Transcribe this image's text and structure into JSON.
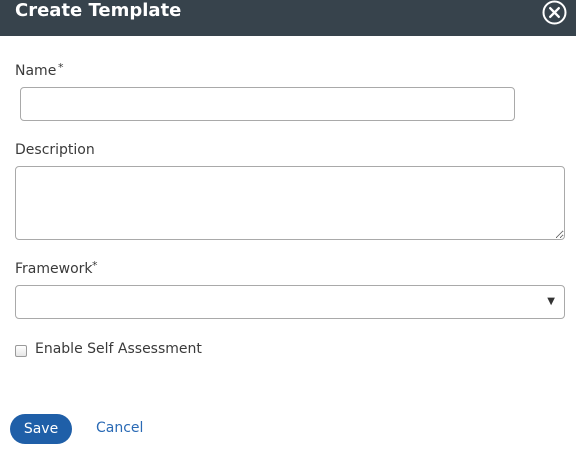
{
  "dialog": {
    "title": "Create Template",
    "close_icon": "close-circle-icon"
  },
  "form": {
    "name": {
      "label": "Name",
      "required_marker": "*",
      "value": "",
      "placeholder": ""
    },
    "description": {
      "label": "Description",
      "value": "",
      "placeholder": ""
    },
    "framework": {
      "label": "Framework",
      "required_marker": "*",
      "selected_value": "",
      "caret_icon": "caret-down-icon"
    },
    "self_assessment": {
      "label": "Enable Self Assessment",
      "checked": false
    }
  },
  "actions": {
    "save_label": "Save",
    "cancel_label": "Cancel"
  },
  "colors": {
    "header_bg": "#37434c",
    "primary_button": "#1f5fa8",
    "link": "#2a6ab5"
  }
}
